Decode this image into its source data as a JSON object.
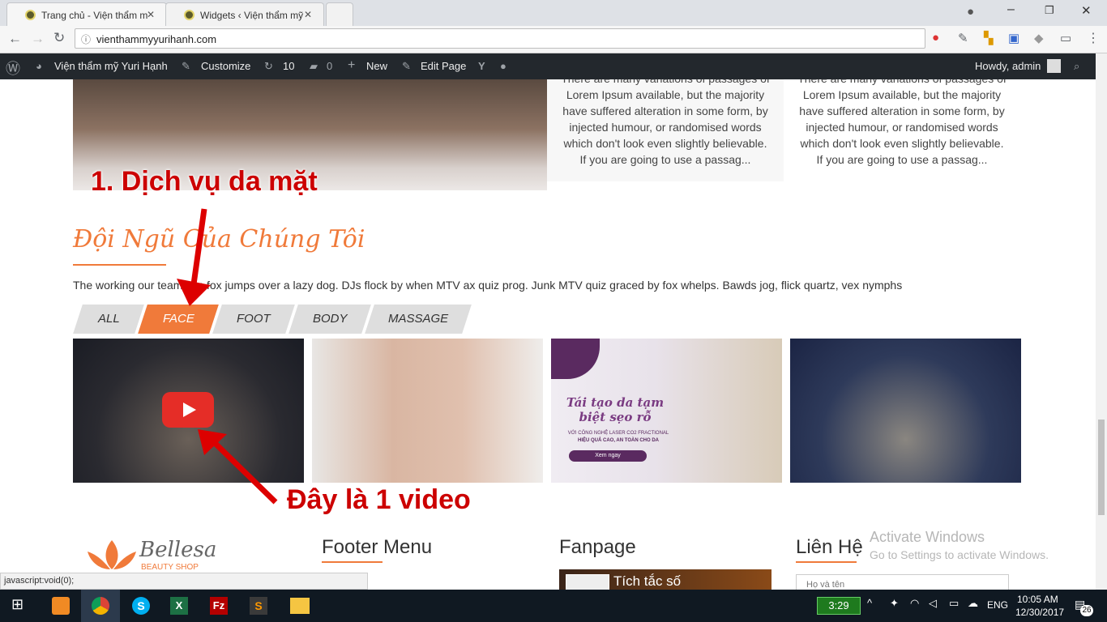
{
  "browser": {
    "tabs": [
      {
        "title": "Trang chủ - Viện thẩm m"
      },
      {
        "title": "Widgets ‹ Viện thẩm mỹ"
      }
    ],
    "url": "vienthammyyurihanh.com"
  },
  "adminbar": {
    "site": "Viện thẩm mỹ Yuri Hạnh",
    "customize": "Customize",
    "updates": "10",
    "comments": "0",
    "new": "New",
    "edit": "Edit Page",
    "howdy": "Howdy, admin"
  },
  "content": {
    "lorem_left": [
      "There are many variations of passages of",
      "Lorem Ipsum available, but the majority",
      "have suffered alteration in some form, by",
      "injected humour, or randomised words",
      "which don't look even slightly believable.",
      "If you are going to use a passag..."
    ],
    "lorem_right": [
      "There are many variations of passages of",
      "Lorem Ipsum available, but the majority",
      "have suffered alteration in some form, by",
      "injected humour, or randomised words",
      "which don't look even slightly believable.",
      "If you are going to use a passag..."
    ],
    "annotation_1": "1. Dịch vụ da mặt",
    "annotation_2": "Đây là 1 video",
    "section_title": "Đội Ngũ Của Chúng Tôi",
    "section_desc": "The working our team. wn fox jumps over a lazy dog. DJs flock by when MTV ax quiz prog. Junk MTV quiz graced by fox whelps. Bawds jog, flick quartz, vex nymphs",
    "filters": [
      {
        "label": "ALL",
        "active": false
      },
      {
        "label": "FACE",
        "active": true
      },
      {
        "label": "FOOT",
        "active": false
      },
      {
        "label": "BODY",
        "active": false
      },
      {
        "label": "MASSAGE",
        "active": false
      }
    ],
    "promo_text": "Tái tạo da tạm biệt sẹo rỗ",
    "promo_sub": "VỚI CÔNG NGHỆ LASER CO2 FRACTIONAL",
    "promo_sub2": "HIỆU QUẢ CAO, AN TOÀN CHO DA",
    "promo_button": "Xem ngay"
  },
  "footer": {
    "logo": "Bellesa",
    "logo_sub": "BEAUTY SHOP",
    "menu_title": "Footer Menu",
    "fanpage_title": "Fanpage",
    "fanpage_post": "Tích tắc số",
    "contact_title": "Liên Hệ",
    "name_placeholder": "Họ và tên"
  },
  "watermark": {
    "line1": "Activate Windows",
    "line2": "Go to Settings to activate Windows."
  },
  "status_bar": "javascript:void(0);",
  "taskbar": {
    "timer": "3:29",
    "lang": "ENG",
    "time": "10:05 AM",
    "date": "12/30/2017",
    "notifications": "26"
  },
  "colors": {
    "accent": "#f07a3a",
    "annotation": "#cc0000",
    "adminbar": "#23282d"
  }
}
